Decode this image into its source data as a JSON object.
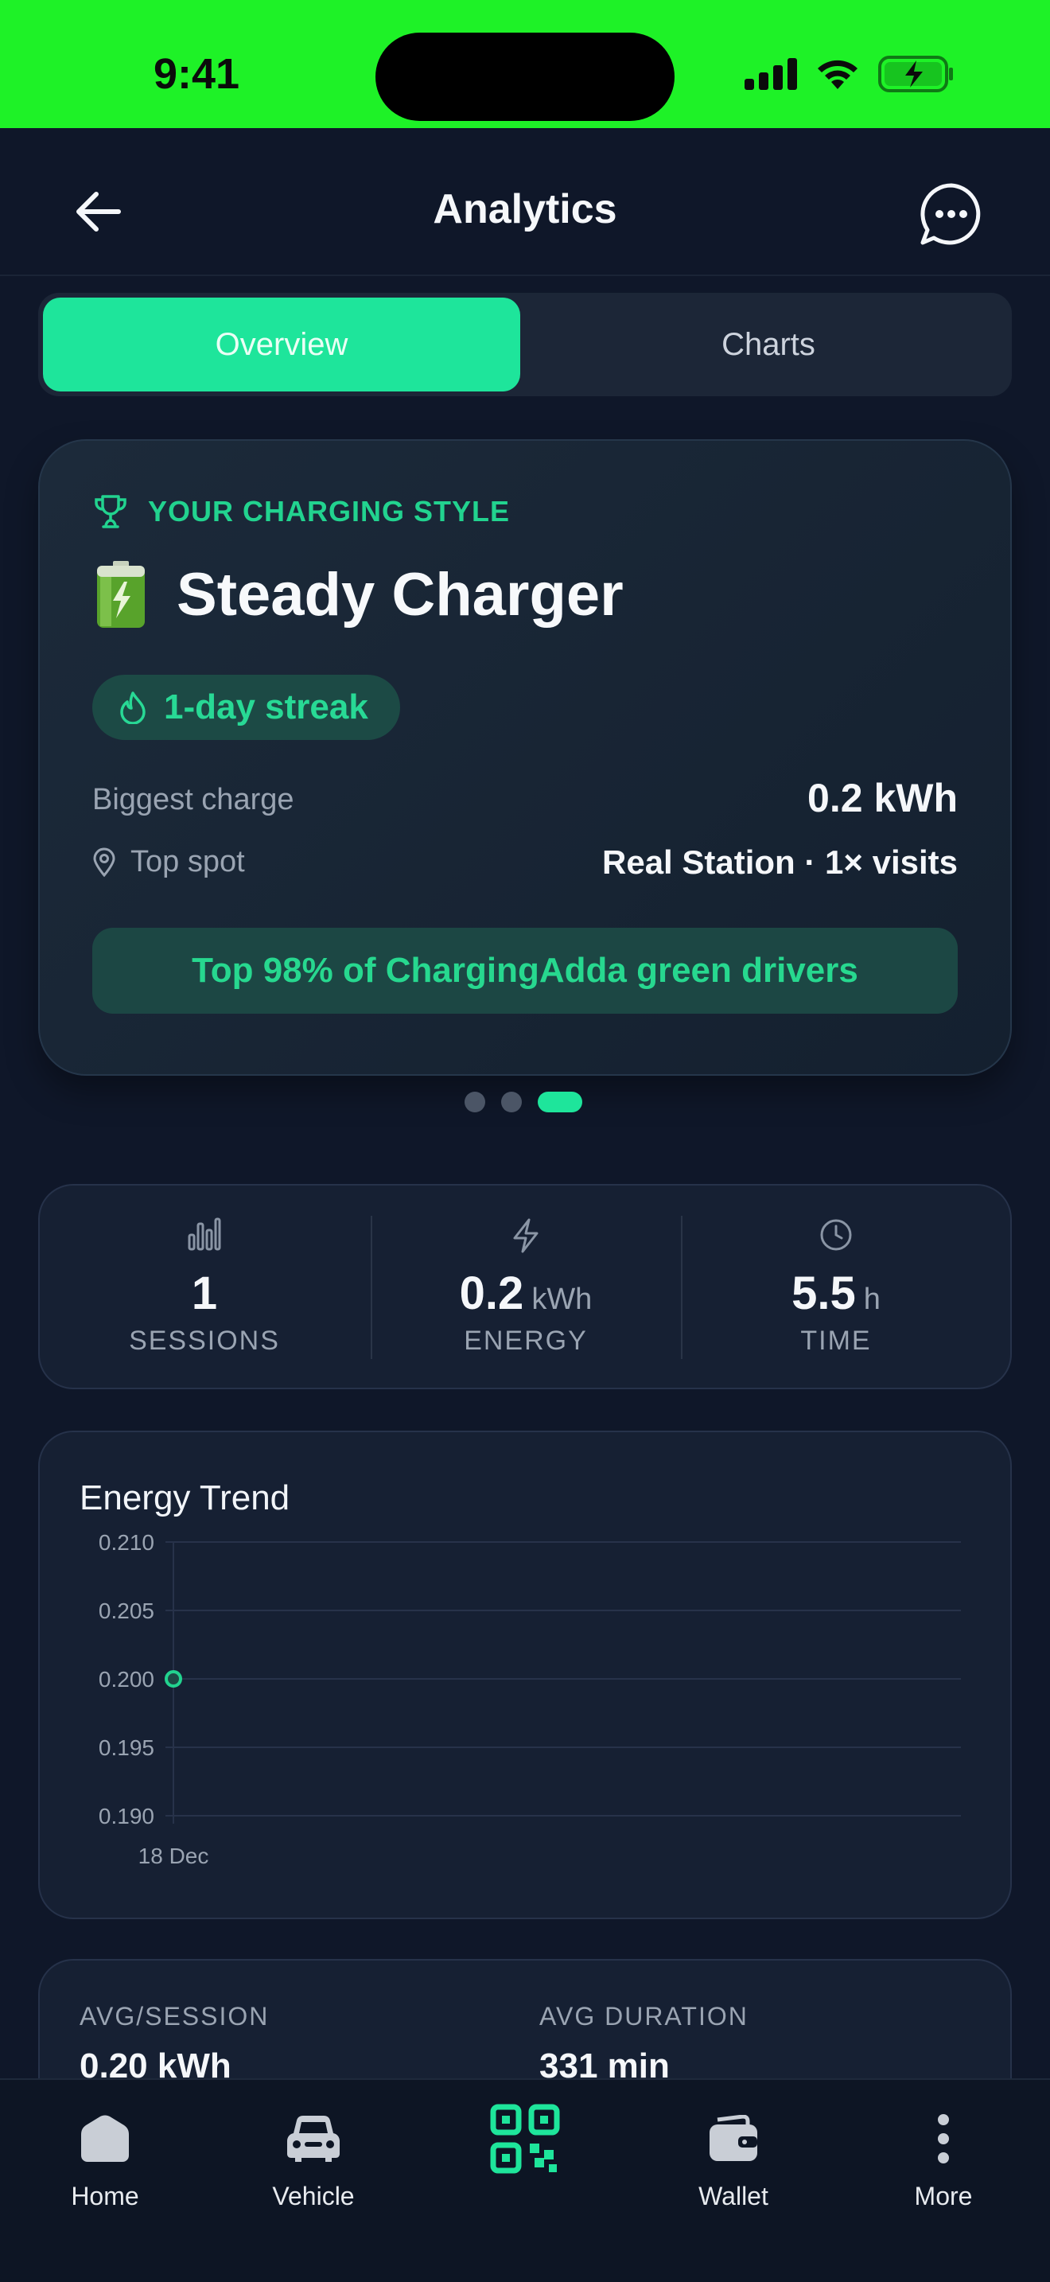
{
  "status_bar": {
    "time": "9:41",
    "bar_color": "#1ef227"
  },
  "header": {
    "title": "Analytics"
  },
  "tabs": [
    {
      "label": "Overview",
      "active": true
    },
    {
      "label": "Charts",
      "active": false
    }
  ],
  "style_card": {
    "label": "YOUR CHARGING STYLE",
    "name": "Steady Charger",
    "streak": "1-day streak",
    "biggest_charge_label": "Biggest charge",
    "biggest_charge_value": "0.2 kWh",
    "top_spot_label": "Top spot",
    "top_spot_value": "Real Station · 1× visits",
    "rank_text": "Top 98% of ChargingAdda green drivers"
  },
  "carousel": {
    "pages": 3,
    "active_index": 2
  },
  "stats": [
    {
      "icon": "bar-chart-icon",
      "value": "1",
      "unit": "",
      "caption": "SESSIONS"
    },
    {
      "icon": "lightning-icon",
      "value": "0.2",
      "unit": "kWh",
      "caption": "ENERGY"
    },
    {
      "icon": "clock-icon",
      "value": "5.5",
      "unit": "h",
      "caption": "TIME"
    }
  ],
  "chart_data": {
    "type": "line",
    "title": "Energy Trend",
    "x": [
      "18 Dec"
    ],
    "series": [
      {
        "values": [
          0.2
        ]
      }
    ],
    "ylim": [
      0.19,
      0.21
    ],
    "yticks": [
      "0.210",
      "0.205",
      "0.200",
      "0.195",
      "0.190"
    ],
    "yticks_num": [
      0.21,
      0.205,
      0.2,
      0.195,
      0.19
    ],
    "grid": true,
    "color": "#22d38f"
  },
  "averages": {
    "avg_session_label": "AVG/SESSION",
    "avg_session_value": "0.20 kWh",
    "avg_duration_label": "AVG DURATION",
    "avg_duration_value": "331 min"
  },
  "nav": [
    {
      "label": "Home",
      "icon": "home-icon"
    },
    {
      "label": "Vehicle",
      "icon": "car-icon"
    },
    {
      "label": "",
      "icon": "qr-code-icon"
    },
    {
      "label": "Wallet",
      "icon": "wallet-icon"
    },
    {
      "label": "More",
      "icon": "more-icon"
    }
  ],
  "colors": {
    "accent": "#1ee59b",
    "background": "#0f1729",
    "card": "#162033"
  }
}
